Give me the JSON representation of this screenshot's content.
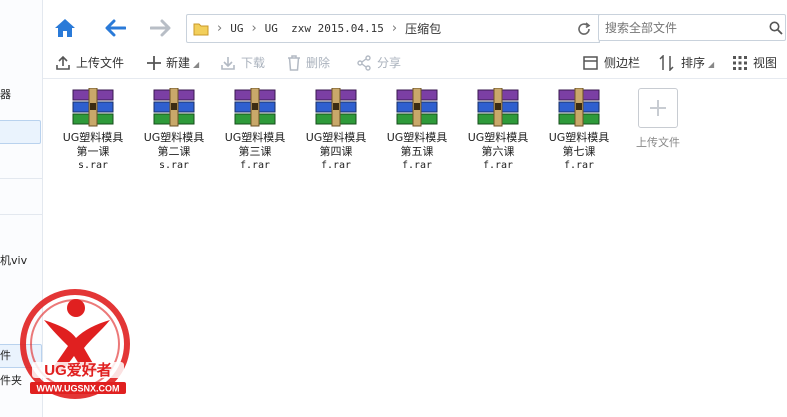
{
  "sidebar": {
    "texts": [
      "器",
      "机viv",
      "件",
      "件夹"
    ]
  },
  "nav": {
    "breadcrumbs": [
      "UG",
      "UG  zxw 2015.04.15",
      "压缩包"
    ],
    "search_placeholder": "搜索全部文件"
  },
  "toolbar": {
    "upload": "上传文件",
    "new": "新建",
    "download": "下载",
    "delete": "删除",
    "share": "分享",
    "sidebar_toggle": "侧边栏",
    "sort": "排序",
    "view": "视图"
  },
  "files": [
    {
      "line1": "UG塑料模具",
      "line2": "第一课",
      "line3": "s.rar"
    },
    {
      "line1": "UG塑料模具",
      "line2": "第二课",
      "line3": "s.rar"
    },
    {
      "line1": "UG塑料模具",
      "line2": "第三课",
      "line3": "f.rar"
    },
    {
      "line1": "UG塑料模具",
      "line2": "第四课",
      "line3": "f.rar"
    },
    {
      "line1": "UG塑料模具",
      "line2": "第五课",
      "line3": "f.rar"
    },
    {
      "line1": "UG塑料模具",
      "line2": "第六课",
      "line3": "f.rar"
    },
    {
      "line1": "UG塑料模具",
      "line2": "第七课",
      "line3": "f.rar"
    }
  ],
  "upload_tile_label": "上传文件",
  "watermark": {
    "brand": "UG爱好者",
    "url": "WWW.UGSNX.COM"
  },
  "colors": {
    "accent": "#2a7ad8",
    "watermark_red": "#e02020"
  }
}
